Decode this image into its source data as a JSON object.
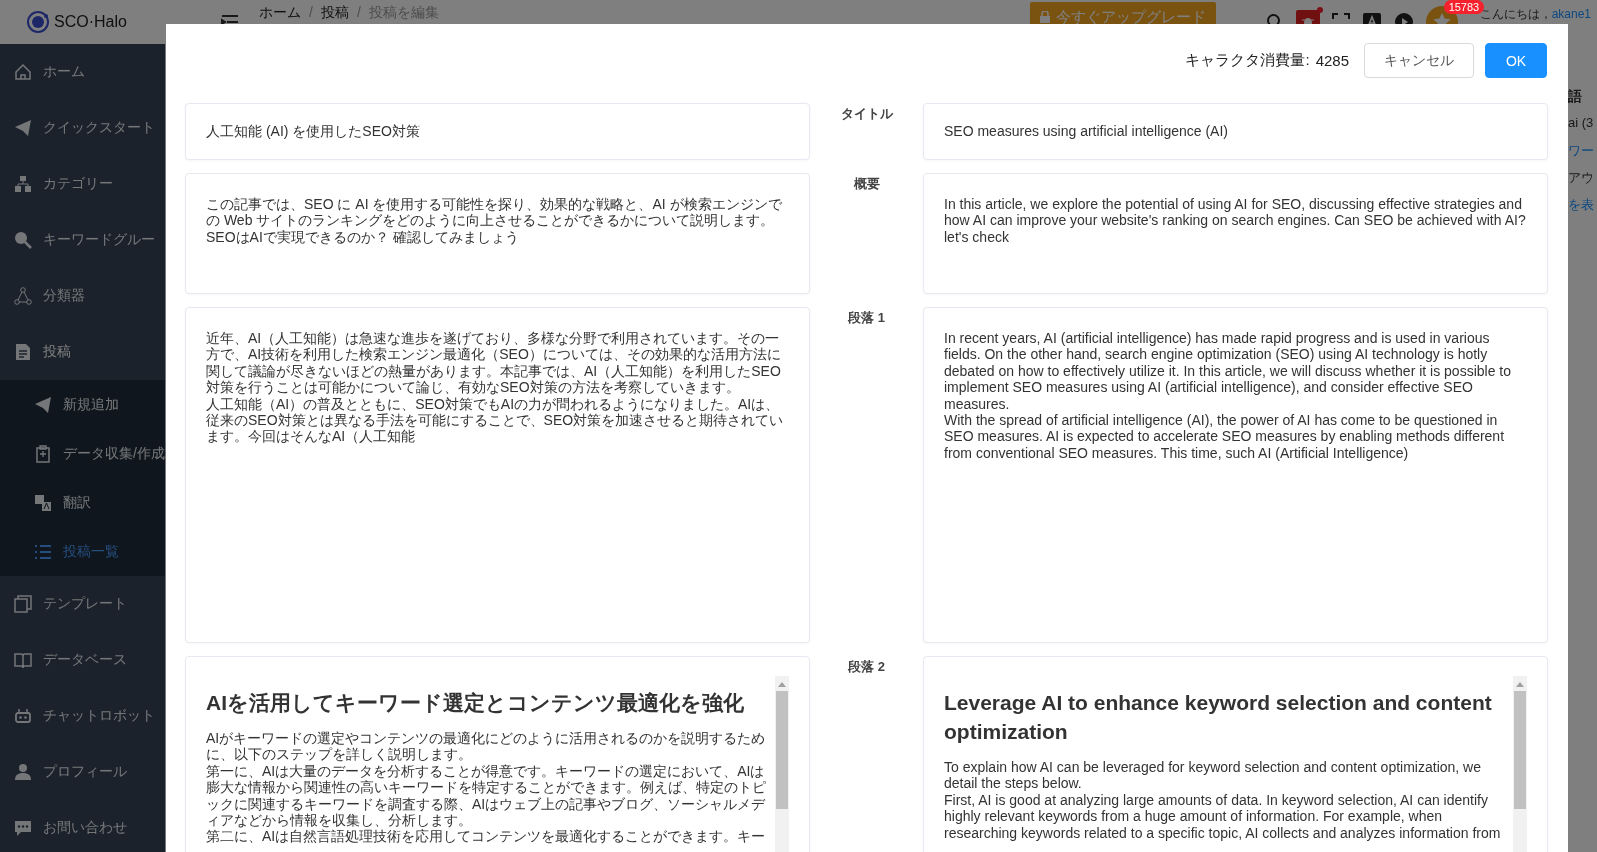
{
  "app": {
    "logo_text": "SCO·Halo",
    "breadcrumb": [
      "ホーム",
      "投稿",
      "投稿を編集"
    ],
    "breadcrumb_separators": [
      "/",
      "/"
    ],
    "upgrade_button": "今すぐアップグレード",
    "notification_count": "15783",
    "greeting": "こんにちは，",
    "username": "akane1"
  },
  "sidebar": {
    "items": [
      {
        "label": "ホーム",
        "selected": false
      },
      {
        "label": "クイックスタート",
        "selected": false
      },
      {
        "label": "カテゴリー",
        "selected": false
      },
      {
        "label": "キーワードグルー",
        "selected": false
      },
      {
        "label": "分類器",
        "selected": false
      },
      {
        "label": "投稿",
        "selected": false,
        "expanded": true,
        "children": [
          {
            "label": "新規追加",
            "selected": false
          },
          {
            "label": "データ収集/作成",
            "selected": false
          },
          {
            "label": "翻訳",
            "selected": false
          },
          {
            "label": "投稿一覧",
            "selected": true
          }
        ]
      },
      {
        "label": "テンプレート",
        "selected": false
      },
      {
        "label": "データベース",
        "selected": false
      },
      {
        "label": "チャットロボット",
        "selected": false
      },
      {
        "label": "プロフィール",
        "selected": false
      },
      {
        "label": "お問い合わせ",
        "selected": false
      }
    ]
  },
  "background_fragments": [
    {
      "text": "語",
      "kind": "heading"
    },
    {
      "text": "ai (3",
      "kind": "plain"
    },
    {
      "text": "ワー",
      "kind": "link"
    },
    {
      "text": "アウ",
      "kind": "plain"
    },
    {
      "text": "を表",
      "kind": "link"
    }
  ],
  "modal": {
    "usage_label": "キャラクタ消費量:",
    "usage_value": "4285",
    "cancel_button": "キャンセル",
    "ok_button": "OK",
    "sections": [
      {
        "label": "タイトル",
        "kind": "line",
        "source": [
          "人工知能 (AI) を使用したSEO対策"
        ],
        "target": [
          "SEO measures using artificial intelligence (AI)"
        ]
      },
      {
        "label": "概要",
        "kind": "text",
        "source": [
          "この記事では、SEO に AI を使用する可能性を探り、効果的な戦略と、AI が検索エンジンでの Web サイトのランキングをどのように向上させることができるかについて説明します。",
          "SEOはAIで実現できるのか？ 確認してみましょう"
        ],
        "target": [
          "In this article, we explore the potential of using AI for SEO, discussing effective strategies and how AI can improve your website's ranking on search engines. Can SEO be achieved with AI? let's check"
        ]
      },
      {
        "label": "段落 1",
        "kind": "text",
        "source": [
          "近年、AI（人工知能）は急速な進歩を遂げており、多様な分野で利用されています。その一方で、AI技術を利用した検索エンジン最適化（SEO）については、その効果的な活用方法に関して議論が尽きないほどの熱量があります。本記事では、AI（人工知能）を利用したSEO対策を行うことは可能かについて論じ、有効なSEO対策の方法を考察していきます。",
          "人工知能（AI）の普及とともに、SEO対策でもAIの力が問われるようになりました。AIは、従来のSEO対策とは異なる手法を可能にすることで、SEO対策を加速させると期待されています。今回はそんなAI（人工知能"
        ],
        "target": [
          "In recent years, AI (artificial intelligence) has made rapid progress and is used in various fields. On the other hand, search engine optimization (SEO) using AI technology is hotly debated on how to effectively utilize it. In this article, we will discuss whether it is possible to implement SEO measures using AI (artificial intelligence), and consider effective SEO measures.",
          "With the spread of artificial intelligence (AI), the power of AI has come to be questioned in SEO measures. AI is expected to accelerate SEO measures by enabling methods different from conventional SEO measures. This time, such AI (Artificial Intelligence)"
        ]
      },
      {
        "label": "段落 2",
        "kind": "rich",
        "source_heading": "AIを活用してキーワード選定とコンテンツ最適化を強化",
        "target_heading": "Leverage AI to enhance keyword selection and content optimization",
        "source": [
          "AIがキーワードの選定やコンテンツの最適化にどのように活用されるのかを説明するために、以下のステップを詳しく説明します。",
          "第一に、AIは大量のデータを分析することが得意です。キーワードの選定において、AIは膨大な情報から関連性の高いキーワードを特定することができます。例えば、特定のトピックに関連するキーワードを調査する際、AIはウェブ上の記事やブログ、ソーシャルメディアなどから情報を収集し、分析します。",
          "第二に、AIは自然言語処理技術を応用してコンテンツを最適化することができます。キー"
        ],
        "target": [
          "To explain how AI can be leveraged for keyword selection and content optimization, we detail the steps below.",
          "First, AI is good at analyzing large amounts of data. In keyword selection, AI can identify highly relevant keywords from a huge amount of information. For example, when researching keywords related to a specific topic, AI collects and analyzes information from"
        ]
      }
    ]
  }
}
